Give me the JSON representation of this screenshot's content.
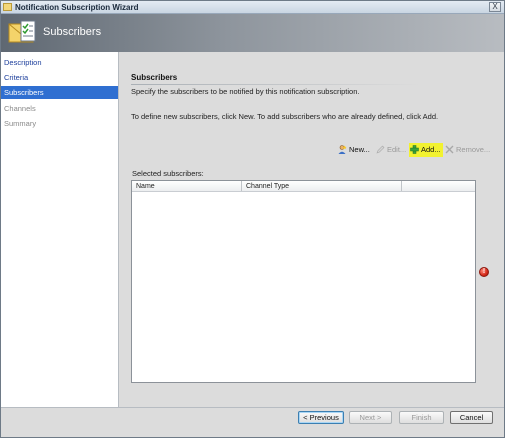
{
  "window": {
    "title": "Notification Subscription Wizard",
    "close_glyph": "X"
  },
  "banner": {
    "title": "Subscribers",
    "icon": "envelope-checklist-icon"
  },
  "sidebar": {
    "items": [
      {
        "label": "Description",
        "state": "link"
      },
      {
        "label": "Criteria",
        "state": "link"
      },
      {
        "label": "Subscribers",
        "state": "selected"
      },
      {
        "label": "Channels",
        "state": "disabled"
      },
      {
        "label": "Summary",
        "state": "disabled"
      }
    ]
  },
  "content": {
    "title": "Subscribers",
    "description": "Specify the subscribers to be notified by this notification subscription.",
    "instructions": "To define new subscribers, click New.  To add subscribers who are already defined, click Add.",
    "toolbar": {
      "new_label": "New...",
      "edit_label": "Edit...",
      "add_label": "Add...",
      "remove_label": "Remove..."
    },
    "selected_label": "Selected subscribers:",
    "columns": [
      "Name",
      "Channel Type"
    ],
    "rows": []
  },
  "validation": {
    "error_glyph": "!"
  },
  "footer": {
    "previous_label": "< Previous",
    "next_label": "Next >",
    "finish_label": "Finish",
    "cancel_label": "Cancel"
  },
  "colors": {
    "selected_nav": "#2f6fd1",
    "link": "#1d3f9c",
    "add_highlight": "#f2f230",
    "error": "#d42a1a"
  }
}
